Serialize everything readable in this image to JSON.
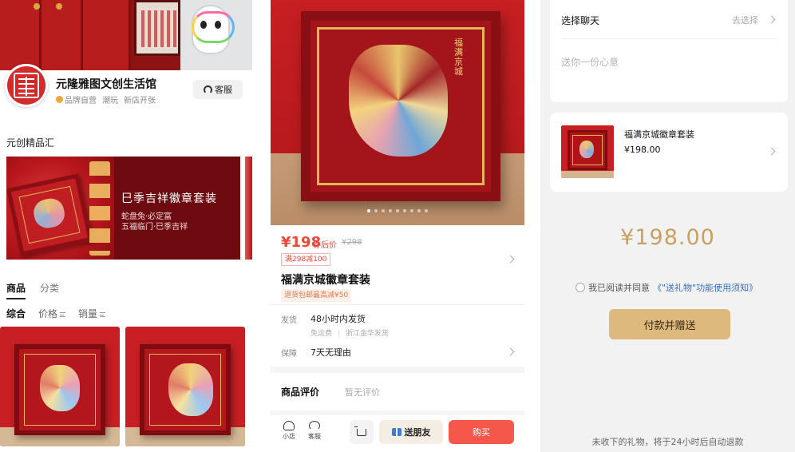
{
  "store": {
    "name": "元隆雅图文创生活馆",
    "tags": [
      "品牌自营",
      "潮玩",
      "新店开张"
    ],
    "service_label": "客服",
    "section_title": "元创精品汇",
    "banner": {
      "title": "巳季吉祥徽章套装",
      "subtitle_1": "蛇盘兔·必定富",
      "subtitle_2": "五福临门·巳季吉祥"
    },
    "tabs": [
      "商品",
      "分类"
    ],
    "sort": [
      "综合",
      "价格",
      "销量"
    ]
  },
  "product": {
    "image_caption": "福满京城",
    "carousel": {
      "count": 9,
      "active": 0
    },
    "price": "¥198",
    "price_label": "券后价",
    "original_price": "¥298",
    "coupon": "满298减100",
    "title": "福满京城徽章套装",
    "return_tag": "退货包邮最高减¥50",
    "shipping_label": "发货",
    "shipping_value": "48小时内发货",
    "shipping_fee": "免运费",
    "shipping_origin": "浙江金华发货",
    "guarantee_label": "保障",
    "guarantee_value": "7天无理由",
    "review_title": "商品评价",
    "review_empty": "暂无评价",
    "bottom_bar": {
      "shop": "小店",
      "service": "客服",
      "send": "送朋友",
      "buy": "购买"
    }
  },
  "gift": {
    "chat_label": "选择聊天",
    "chat_choose": "去选择",
    "message_placeholder": "送你一份心意",
    "item_name": "福满京城徽章套装",
    "item_price": "¥198.00",
    "total": "¥198.00",
    "agree_text": "我已阅读并同意",
    "agree_link": "《\"送礼物\"功能使用须知》",
    "pay_button": "付款并赠送",
    "footer_note": "未收下的礼物，将于24小时后自动退款"
  },
  "colors": {
    "accent_red": "#ee4736",
    "buy_red": "#f5574a",
    "gold": "#c9a060",
    "pay_gold": "#deb97d",
    "link_blue": "#3a6fc4"
  }
}
